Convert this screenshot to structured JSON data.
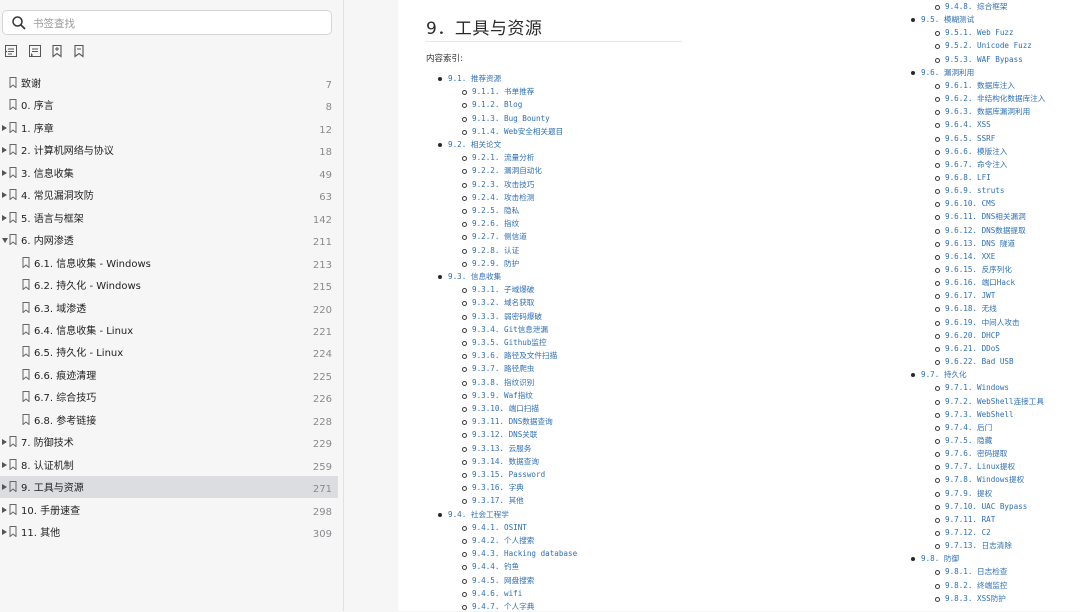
{
  "search": {
    "placeholder": "书签查找"
  },
  "toolbar": {
    "icons": [
      "bookmark-expand-icon",
      "bookmark-collapse-icon",
      "bookmark-add-icon",
      "bookmark-outline-icon"
    ]
  },
  "toc": [
    {
      "label": "致谢",
      "page": "7",
      "level": 0,
      "arrow": "none"
    },
    {
      "label": "0. 序言",
      "page": "8",
      "level": 0,
      "arrow": "none"
    },
    {
      "label": "1. 序章",
      "page": "12",
      "level": 0,
      "arrow": "right"
    },
    {
      "label": "2. 计算机网络与协议",
      "page": "18",
      "level": 0,
      "arrow": "right"
    },
    {
      "label": "3. 信息收集",
      "page": "49",
      "level": 0,
      "arrow": "right"
    },
    {
      "label": "4. 常见漏洞攻防",
      "page": "63",
      "level": 0,
      "arrow": "right"
    },
    {
      "label": "5. 语言与框架",
      "page": "142",
      "level": 0,
      "arrow": "right"
    },
    {
      "label": "6. 内网渗透",
      "page": "211",
      "level": 0,
      "arrow": "down"
    },
    {
      "label": "6.1. 信息收集 - Windows",
      "page": "213",
      "level": 1,
      "arrow": "none"
    },
    {
      "label": "6.2. 持久化 - Windows",
      "page": "215",
      "level": 1,
      "arrow": "none"
    },
    {
      "label": "6.3. 域渗透",
      "page": "220",
      "level": 1,
      "arrow": "none"
    },
    {
      "label": "6.4. 信息收集 - Linux",
      "page": "221",
      "level": 1,
      "arrow": "none"
    },
    {
      "label": "6.5. 持久化 - Linux",
      "page": "224",
      "level": 1,
      "arrow": "none"
    },
    {
      "label": "6.6. 痕迹清理",
      "page": "225",
      "level": 1,
      "arrow": "none"
    },
    {
      "label": "6.7. 综合技巧",
      "page": "226",
      "level": 1,
      "arrow": "none"
    },
    {
      "label": "6.8. 参考链接",
      "page": "228",
      "level": 1,
      "arrow": "none"
    },
    {
      "label": "7. 防御技术",
      "page": "229",
      "level": 0,
      "arrow": "right"
    },
    {
      "label": "8. 认证机制",
      "page": "259",
      "level": 0,
      "arrow": "right"
    },
    {
      "label": "9. 工具与资源",
      "page": "271",
      "level": 0,
      "arrow": "right",
      "active": true
    },
    {
      "label": "10. 手册速查",
      "page": "298",
      "level": 0,
      "arrow": "right"
    },
    {
      "label": "11. 其他",
      "page": "309",
      "level": 0,
      "arrow": "right"
    }
  ],
  "content": {
    "title": "9．工具与资源",
    "index_label": "内容索引:",
    "col1": [
      {
        "t": "9.1. 推荐资源",
        "l": 0
      },
      {
        "t": "9.1.1. 书单推荐",
        "l": 1
      },
      {
        "t": "9.1.2. Blog",
        "l": 1
      },
      {
        "t": "9.1.3. Bug Bounty",
        "l": 1
      },
      {
        "t": "9.1.4. Web安全相关题目",
        "l": 1
      },
      {
        "t": "9.2. 相关论文",
        "l": 0
      },
      {
        "t": "9.2.1. 流量分析",
        "l": 1
      },
      {
        "t": "9.2.2. 漏洞自动化",
        "l": 1
      },
      {
        "t": "9.2.3. 攻击技巧",
        "l": 1
      },
      {
        "t": "9.2.4. 攻击检测",
        "l": 1
      },
      {
        "t": "9.2.5. 隐私",
        "l": 1
      },
      {
        "t": "9.2.6. 指纹",
        "l": 1
      },
      {
        "t": "9.2.7. 侧信道",
        "l": 1
      },
      {
        "t": "9.2.8. 认证",
        "l": 1
      },
      {
        "t": "9.2.9. 防护",
        "l": 1
      },
      {
        "t": "9.3. 信息收集",
        "l": 0
      },
      {
        "t": "9.3.1. 子域爆破",
        "l": 1
      },
      {
        "t": "9.3.2. 域名获取",
        "l": 1
      },
      {
        "t": "9.3.3. 弱密码爆破",
        "l": 1
      },
      {
        "t": "9.3.4. Git信息泄漏",
        "l": 1
      },
      {
        "t": "9.3.5. Github监控",
        "l": 1
      },
      {
        "t": "9.3.6. 路径及文件扫描",
        "l": 1
      },
      {
        "t": "9.3.7. 路径爬虫",
        "l": 1
      },
      {
        "t": "9.3.8. 指纹识别",
        "l": 1
      },
      {
        "t": "9.3.9. Waf指纹",
        "l": 1
      },
      {
        "t": "9.3.10. 端口扫描",
        "l": 1
      },
      {
        "t": "9.3.11. DNS数据查询",
        "l": 1
      },
      {
        "t": "9.3.12. DNS关联",
        "l": 1
      },
      {
        "t": "9.3.13. 云服务",
        "l": 1
      },
      {
        "t": "9.3.14. 数据查询",
        "l": 1
      },
      {
        "t": "9.3.15. Password",
        "l": 1
      },
      {
        "t": "9.3.16. 字典",
        "l": 1
      },
      {
        "t": "9.3.17. 其他",
        "l": 1
      },
      {
        "t": "9.4. 社会工程学",
        "l": 0
      },
      {
        "t": "9.4.1. OSINT",
        "l": 1
      },
      {
        "t": "9.4.2. 个人搜索",
        "l": 1
      },
      {
        "t": "9.4.3. Hacking database",
        "l": 1
      },
      {
        "t": "9.4.4. 钓鱼",
        "l": 1
      },
      {
        "t": "9.4.5. 网盘搜索",
        "l": 1
      },
      {
        "t": "9.4.6. wifi",
        "l": 1
      },
      {
        "t": "9.4.7. 个人字典",
        "l": 1
      }
    ],
    "col2": [
      {
        "t": "9.4.8. 综合框架",
        "l": 1
      },
      {
        "t": "9.5. 模糊测试",
        "l": 0
      },
      {
        "t": "9.5.1. Web Fuzz",
        "l": 1
      },
      {
        "t": "9.5.2. Unicode Fuzz",
        "l": 1
      },
      {
        "t": "9.5.3. WAF Bypass",
        "l": 1
      },
      {
        "t": "9.6. 漏洞利用",
        "l": 0
      },
      {
        "t": "9.6.1. 数据库注入",
        "l": 1
      },
      {
        "t": "9.6.2. 非结构化数据库注入",
        "l": 1
      },
      {
        "t": "9.6.3. 数据库漏洞利用",
        "l": 1
      },
      {
        "t": "9.6.4. XSS",
        "l": 1
      },
      {
        "t": "9.6.5. SSRF",
        "l": 1
      },
      {
        "t": "9.6.6. 模版注入",
        "l": 1
      },
      {
        "t": "9.6.7. 命令注入",
        "l": 1
      },
      {
        "t": "9.6.8. LFI",
        "l": 1
      },
      {
        "t": "9.6.9. struts",
        "l": 1
      },
      {
        "t": "9.6.10. CMS",
        "l": 1
      },
      {
        "t": "9.6.11. DNS相关漏洞",
        "l": 1
      },
      {
        "t": "9.6.12. DNS数据提取",
        "l": 1
      },
      {
        "t": "9.6.13. DNS 隧道",
        "l": 1
      },
      {
        "t": "9.6.14. XXE",
        "l": 1
      },
      {
        "t": "9.6.15. 反序列化",
        "l": 1
      },
      {
        "t": "9.6.16. 端口Hack",
        "l": 1
      },
      {
        "t": "9.6.17. JWT",
        "l": 1
      },
      {
        "t": "9.6.18. 无线",
        "l": 1
      },
      {
        "t": "9.6.19. 中间人攻击",
        "l": 1
      },
      {
        "t": "9.6.20. DHCP",
        "l": 1
      },
      {
        "t": "9.6.21. DDoS",
        "l": 1
      },
      {
        "t": "9.6.22. Bad USB",
        "l": 1
      },
      {
        "t": "9.7. 持久化",
        "l": 0
      },
      {
        "t": "9.7.1. Windows",
        "l": 1
      },
      {
        "t": "9.7.2. WebShell连接工具",
        "l": 1
      },
      {
        "t": "9.7.3. WebShell",
        "l": 1
      },
      {
        "t": "9.7.4. 后门",
        "l": 1
      },
      {
        "t": "9.7.5. 隐藏",
        "l": 1
      },
      {
        "t": "9.7.6. 密码提取",
        "l": 1
      },
      {
        "t": "9.7.7. Linux提权",
        "l": 1
      },
      {
        "t": "9.7.8. Windows提权",
        "l": 1
      },
      {
        "t": "9.7.9. 提权",
        "l": 1
      },
      {
        "t": "9.7.10. UAC Bypass",
        "l": 1
      },
      {
        "t": "9.7.11. RAT",
        "l": 1
      },
      {
        "t": "9.7.12. C2",
        "l": 1
      },
      {
        "t": "9.7.13. 日志清除",
        "l": 1
      },
      {
        "t": "9.8. 防御",
        "l": 0
      },
      {
        "t": "9.8.1. 日志检查",
        "l": 1
      },
      {
        "t": "9.8.2. 终端监控",
        "l": 1
      },
      {
        "t": "9.8.3. XSS防护",
        "l": 1
      }
    ]
  },
  "colors": {
    "link": "#2e6fb8",
    "active_bg": "#dcdde1"
  }
}
